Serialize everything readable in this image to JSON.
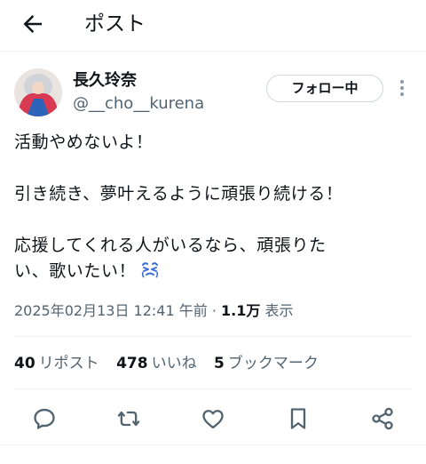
{
  "header": {
    "title": "ポスト"
  },
  "author": {
    "display_name": "長久玲奈",
    "handle": "@__cho__kurena"
  },
  "follow_button": {
    "label": "フォロー中"
  },
  "tweet": {
    "line1": "活動やめないよ！",
    "line2": "引き続き、夢叶えるように頑張り続ける！",
    "line3": "応援してくれる人がいるなら、頑張りた",
    "line4": "い、歌いたい！",
    "emoji": "crying-face"
  },
  "meta": {
    "timestamp": "2025年02月13日 12:41 午前",
    "separator": "·",
    "views_count": "1.1万",
    "views_label": "表示"
  },
  "stats": {
    "reposts_count": "40",
    "reposts_label": "リポスト",
    "likes_count": "478",
    "likes_label": "いいね",
    "bookmarks_count": "5",
    "bookmarks_label": "ブックマーク"
  },
  "actions": [
    "reply-icon",
    "repost-icon",
    "like-icon",
    "bookmark-icon",
    "share-icon"
  ],
  "colors": {
    "text": "#0f1419",
    "secondary": "#536471",
    "divider": "#eff3f4"
  }
}
